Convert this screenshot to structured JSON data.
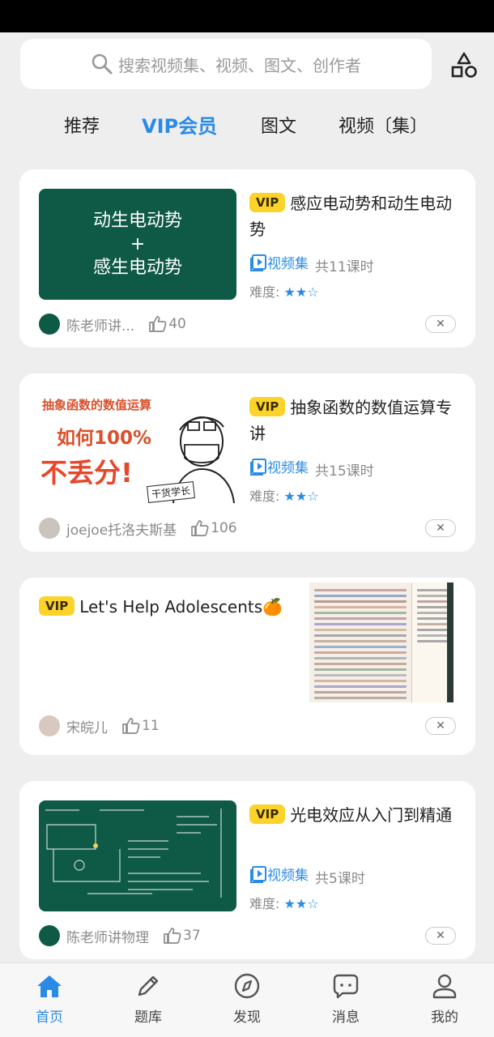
{
  "search": {
    "placeholder": "搜索视频集、视频、图文、创作者"
  },
  "tabs": [
    "推荐",
    "VIP会员",
    "图文",
    "视频〔集〕"
  ],
  "active_tab": 1,
  "colors": {
    "accent": "#2a8be6",
    "vip": "#fcd32a",
    "thumb_green": "#0f5a47"
  },
  "cards": [
    {
      "vip": "VIP",
      "title": "感应电动势和动生电动势",
      "thumb_text": [
        "动生电动势",
        "+",
        "感生电动势"
      ],
      "type": "视频集",
      "lessons": "共11课时",
      "difficulty_label": "难度:",
      "stars": "★★☆",
      "rating": 2,
      "author": "陈老师讲...",
      "likes": "40"
    },
    {
      "vip": "VIP",
      "title": "抽象函数的数值运算专讲",
      "thumb_text": [
        "抽象函数的数值运算",
        "如何100%",
        "不丢分!",
        "干货学长"
      ],
      "type": "视频集",
      "lessons": "共15课时",
      "difficulty_label": "难度:",
      "stars": "★★☆",
      "rating": 2,
      "author": "joejoe托洛夫斯基",
      "likes": "106"
    },
    {
      "vip": "VIP",
      "title": "Let's Help Adolescents🍊",
      "author": "宋皖儿",
      "likes": "11"
    },
    {
      "vip": "VIP",
      "title": "光电效应从入门到精通",
      "type": "视频集",
      "lessons": "共5课时",
      "difficulty_label": "难度:",
      "stars": "★★☆",
      "rating": 2,
      "author": "陈老师讲物理",
      "likes": "37"
    }
  ],
  "bottom_nav": [
    {
      "label": "首页",
      "icon": "home-icon",
      "active": true
    },
    {
      "label": "题库",
      "icon": "pencil-icon"
    },
    {
      "label": "发现",
      "icon": "compass-icon"
    },
    {
      "label": "消息",
      "icon": "message-icon"
    },
    {
      "label": "我的",
      "icon": "user-icon"
    }
  ]
}
